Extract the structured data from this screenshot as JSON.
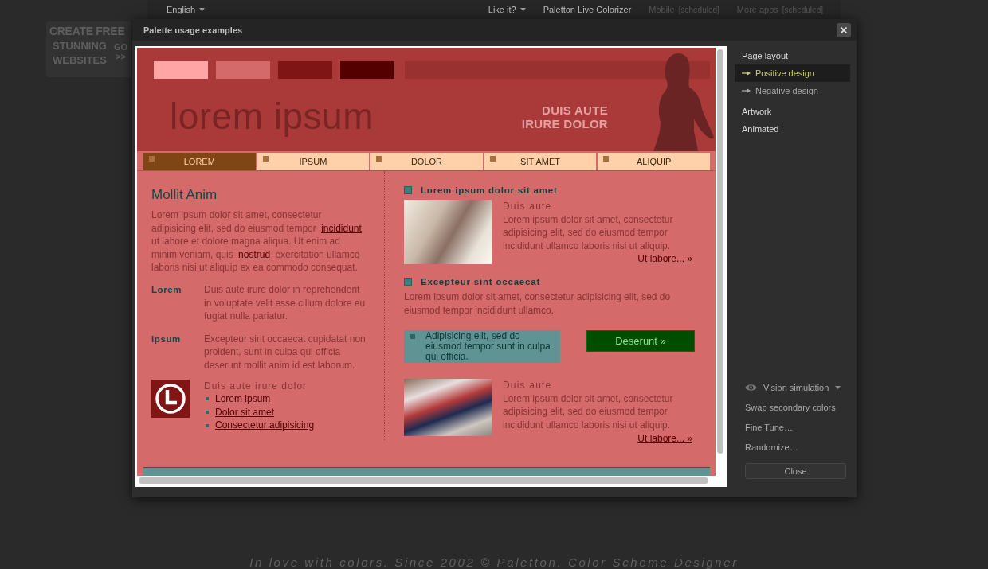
{
  "top_nav": {
    "ad": {
      "headline": "CREATE FREE",
      "lines": [
        "STUNNING",
        "WEBSITES"
      ],
      "cta": [
        "GO",
        ">>"
      ]
    },
    "items": [
      {
        "label": "English",
        "kind": "dropdown",
        "disabled": false
      },
      {
        "label": "Like it?",
        "kind": "dropdown",
        "disabled": false
      },
      {
        "label": "Paletton Live Colorizer",
        "kind": "link",
        "disabled": false
      },
      {
        "label": "Mobile",
        "note": "[scheduled]",
        "kind": "link",
        "disabled": true
      },
      {
        "label": "More apps",
        "note": "[scheduled]",
        "kind": "link",
        "disabled": true
      }
    ]
  },
  "dialog": {
    "title": "Palette usage examples",
    "preview": {
      "header": {
        "swatches": [
          {
            "color": "#ffa5a5"
          },
          {
            "color": "#d46a6a"
          },
          {
            "color": "#801515"
          },
          {
            "color": "#550000"
          }
        ],
        "logo": "lorem ipsum",
        "tagline": [
          "DUIS AUTE",
          "IRURE DOLOR"
        ]
      },
      "nav": [
        {
          "label": "LOREM",
          "selected": true
        },
        {
          "label": "IPSUM",
          "selected": false
        },
        {
          "label": "DOLOR",
          "selected": false
        },
        {
          "label": "SIT AMET",
          "selected": false
        },
        {
          "label": "ALIQUIP",
          "selected": false
        }
      ],
      "left": {
        "heading": "Mollit Anim",
        "intro": [
          {
            "kind": "text",
            "text": "Lorem ipsum dolor sit amet, consectetur adipisicing elit, sed do eiusmod tempor "
          },
          {
            "kind": "link",
            "text": "incididunt"
          },
          {
            "kind": "text",
            "text": " ut labore et dolore magna aliqua. Ut enim ad minim veniam, quis "
          },
          {
            "kind": "link",
            "text": "nostrud"
          },
          {
            "kind": "text",
            "text": " exercitation ullamco laboris nisi ut aliquip ex ea commodo consequat."
          }
        ],
        "definitions": [
          {
            "term": "Lorem",
            "description": "Duis aute irure dolor in reprehenderit in voluptate velit esse cillum dolore eu fugiat nulla pariatur."
          },
          {
            "term": "Ipsum",
            "description": "Excepteur sint occaecat cupidatat non proident, sunt in culpa qui officia deserunt mollit anim id est laborum."
          }
        ],
        "list_title": "Duis aute irure dolor",
        "links": [
          "Lorem ipsum",
          "Dolor sit amet",
          "Consectetur adipisicing"
        ]
      },
      "right": [
        {
          "kind": "heading",
          "text": "Lorem ipsum dolor sit amet"
        },
        {
          "kind": "article",
          "title": "Duis aute",
          "text": "Lorem ipsum dolor sit amet, consectetur adipisicing elit, sed do eiusmod tempor incididunt ullamco laboris nisi ut aliquip.",
          "link": "Ut labore... »"
        },
        {
          "kind": "heading",
          "text": "Excepteur sint occaecat"
        },
        {
          "kind": "paragraph",
          "text": "Lorem ipsum dolor sit amet, consectetur adipisicing elit, sed do eiusmod tempor incididunt ullamco."
        },
        {
          "kind": "callout",
          "text": "Adipisicing elit, sed do eiusmod tempor sunt in culpa qui officia.",
          "button": "Deserunt »"
        },
        {
          "kind": "article",
          "title": "Duis aute",
          "text": "Lorem ipsum dolor sit amet, consectetur adipisicing elit, sed do eiusmod tempor incididunt ullamco laboris nisi ut aliquip.",
          "link": "Ut labore... »"
        }
      ]
    },
    "sidebar": {
      "items": [
        {
          "label": "Page layout",
          "selected": false,
          "children": [
            {
              "label": "Positive design",
              "selected": true
            },
            {
              "label": "Negative design",
              "selected": false
            }
          ]
        },
        {
          "label": "Artwork",
          "selected": false
        },
        {
          "label": "Animated",
          "selected": false
        }
      ],
      "tools": [
        {
          "label": "Vision simulation",
          "kind": "dropdown"
        },
        {
          "label": "Swap secondary colors",
          "kind": "action"
        },
        {
          "label": "Fine Tune…",
          "kind": "action"
        },
        {
          "label": "Randomize…",
          "kind": "action"
        }
      ],
      "close_button": "Close"
    }
  },
  "footer": "In love with colors. Since 2002 © Paletton. Color Scheme Designer"
}
